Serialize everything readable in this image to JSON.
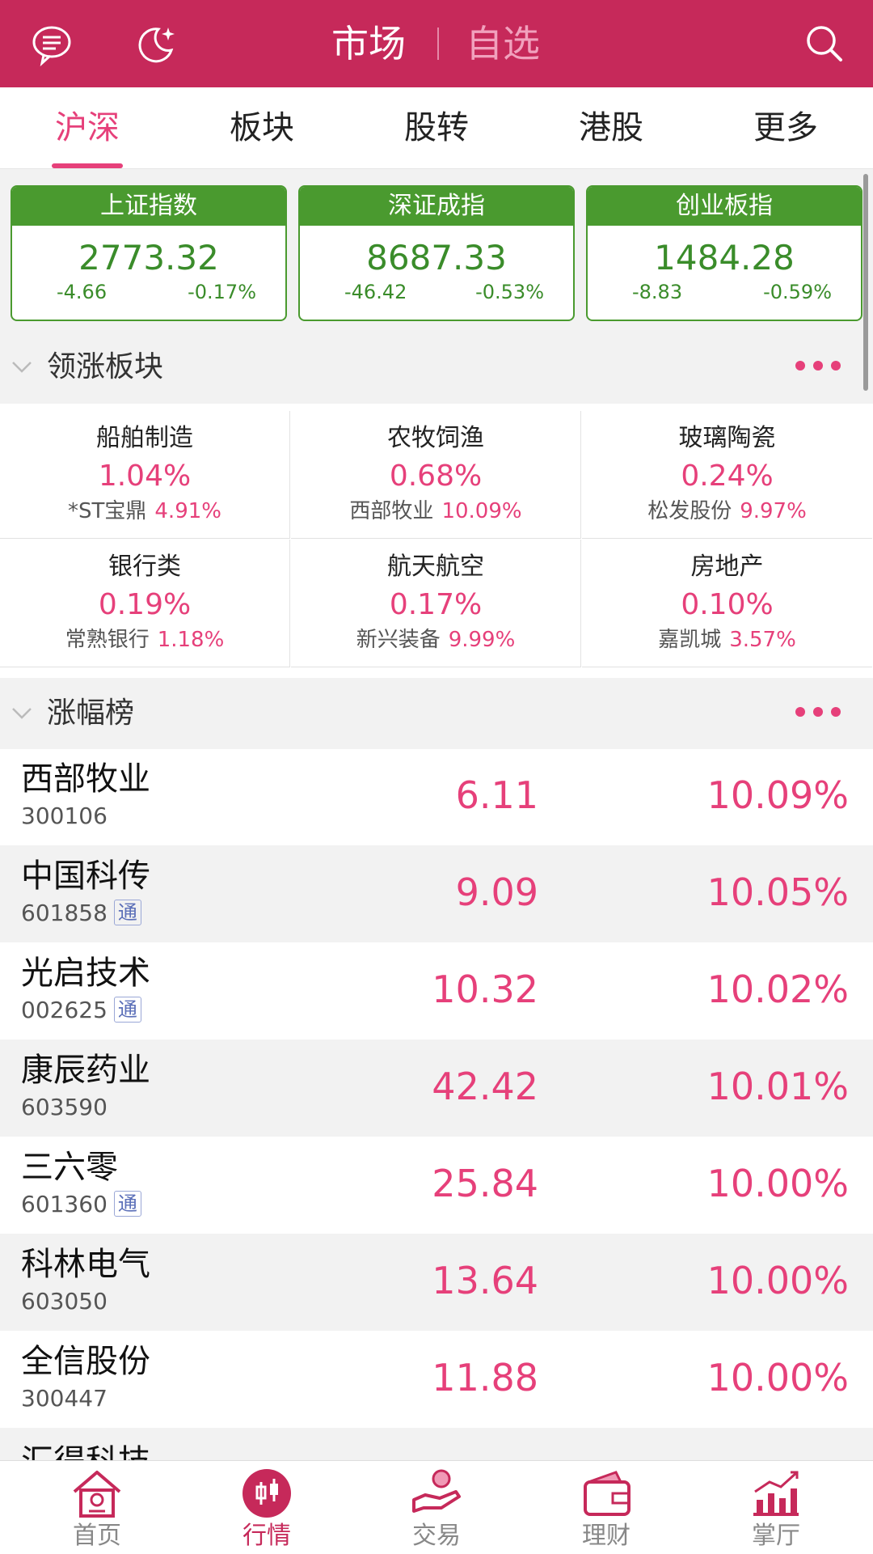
{
  "header": {
    "title_market": "市场",
    "title_watch": "自选",
    "colors": {
      "bar": "#c6295a",
      "active_text": "#ffffff",
      "inactive_text": "#f1a1bd"
    }
  },
  "tabs": [
    {
      "label": "沪深",
      "active": true
    },
    {
      "label": "板块",
      "active": false
    },
    {
      "label": "股转",
      "active": false
    },
    {
      "label": "港股",
      "active": false
    },
    {
      "label": "更多",
      "active": false
    }
  ],
  "indices": [
    {
      "name": "上证指数",
      "value": "2773.32",
      "change": "-4.66",
      "pct": "-0.17%"
    },
    {
      "name": "深证成指",
      "value": "8687.33",
      "change": "-46.42",
      "pct": "-0.53%"
    },
    {
      "name": "创业板指",
      "value": "1484.28",
      "change": "-8.83",
      "pct": "-0.59%"
    }
  ],
  "leading_sectors": {
    "title": "领涨板块",
    "items": [
      {
        "name": "船舶制造",
        "pct": "1.04%",
        "top_stock": "*ST宝鼎",
        "top_pct": "4.91%"
      },
      {
        "name": "农牧饲渔",
        "pct": "0.68%",
        "top_stock": "西部牧业",
        "top_pct": "10.09%"
      },
      {
        "name": "玻璃陶瓷",
        "pct": "0.24%",
        "top_stock": "松发股份",
        "top_pct": "9.97%"
      },
      {
        "name": "银行类",
        "pct": "0.19%",
        "top_stock": "常熟银行",
        "top_pct": "1.18%"
      },
      {
        "name": "航天航空",
        "pct": "0.17%",
        "top_stock": "新兴装备",
        "top_pct": "9.99%"
      },
      {
        "name": "房地产",
        "pct": "0.10%",
        "top_stock": "嘉凯城",
        "top_pct": "3.57%"
      }
    ]
  },
  "gainers": {
    "title": "涨幅榜",
    "badge_text": "通",
    "rows": [
      {
        "name": "西部牧业",
        "code": "300106",
        "badge": false,
        "price": "6.11",
        "pct": "10.09%"
      },
      {
        "name": "中国科传",
        "code": "601858",
        "badge": true,
        "price": "9.09",
        "pct": "10.05%"
      },
      {
        "name": "光启技术",
        "code": "002625",
        "badge": true,
        "price": "10.32",
        "pct": "10.02%"
      },
      {
        "name": "康辰药业",
        "code": "603590",
        "badge": false,
        "price": "42.42",
        "pct": "10.01%"
      },
      {
        "name": "三六零",
        "code": "601360",
        "badge": true,
        "price": "25.84",
        "pct": "10.00%"
      },
      {
        "name": "科林电气",
        "code": "603050",
        "badge": false,
        "price": "13.64",
        "pct": "10.00%"
      },
      {
        "name": "全信股份",
        "code": "300447",
        "badge": false,
        "price": "11.88",
        "pct": "10.00%"
      }
    ],
    "partial_row_name": "汇得科技"
  },
  "bottom_nav": [
    {
      "label": "首页",
      "icon": "home-icon",
      "active": false
    },
    {
      "label": "行情",
      "icon": "candlestick-icon",
      "active": true
    },
    {
      "label": "交易",
      "icon": "trade-hand-icon",
      "active": false
    },
    {
      "label": "理财",
      "icon": "wallet-icon",
      "active": false
    },
    {
      "label": "掌厅",
      "icon": "chart-trend-icon",
      "active": false
    }
  ],
  "colors": {
    "up": "#e6407a",
    "down": "#3a8c2a",
    "index_card": "#4a9a2f"
  }
}
